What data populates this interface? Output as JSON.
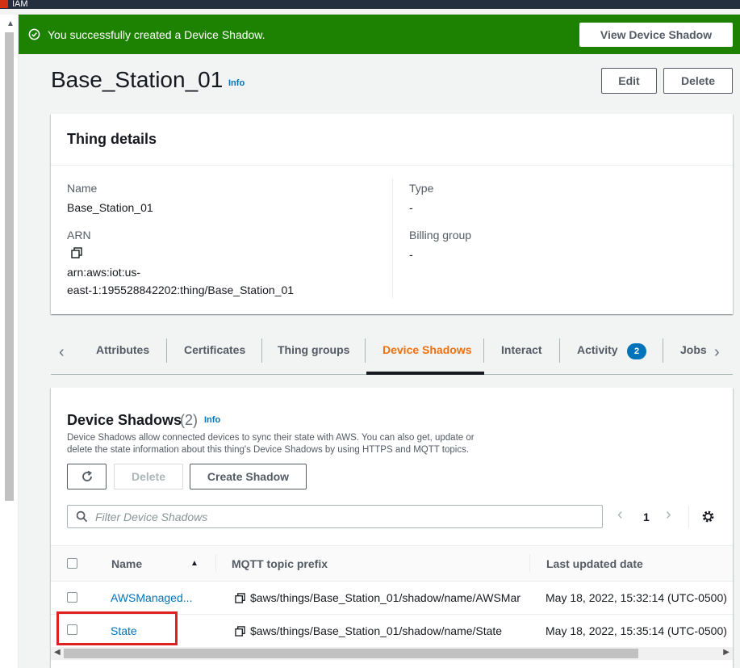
{
  "topbar": {
    "service": "IAM"
  },
  "flash": {
    "message": "You successfully created a Device Shadow.",
    "button": "View Device Shadow",
    "color": "#1d8102"
  },
  "header": {
    "title": "Base_Station_01",
    "info": "Info",
    "edit": "Edit",
    "delete": "Delete"
  },
  "details": {
    "title": "Thing details",
    "name_label": "Name",
    "name_value": "Base_Station_01",
    "arn_label": "ARN",
    "arn_line1": "arn:aws:iot:us-",
    "arn_line2": "east-1:195528842202:thing/Base_Station_01",
    "type_label": "Type",
    "type_value": "-",
    "billing_label": "Billing group",
    "billing_value": "-"
  },
  "tabs": {
    "items": [
      "Attributes",
      "Certificates",
      "Thing groups",
      "Device Shadows",
      "Interact",
      "Activity",
      "Jobs"
    ],
    "active": "Device Shadows",
    "activity_badge": "2",
    "accent": "#ec7211"
  },
  "shadows": {
    "title": "Device Shadows",
    "count": "(2)",
    "info": "Info",
    "desc_line1": "Device Shadows allow connected devices to sync their state with AWS. You can also get, update or",
    "desc_line2": "delete the state information about this thing's Device Shadows by using HTTPS and MQTT topics.",
    "delete": "Delete",
    "create": "Create Shadow",
    "filter_placeholder": "Filter Device Shadows",
    "page": "1",
    "columns": [
      "Name",
      "MQTT topic prefix",
      "Last updated date"
    ],
    "rows": [
      {
        "name": "AWSManaged...",
        "topic": "$aws/things/Base_Station_01/shadow/name/AWSMar",
        "updated": "May 18, 2022, 15:32:14 (UTC-0500)"
      },
      {
        "name": "State",
        "topic": "$aws/things/Base_Station_01/shadow/name/State",
        "updated": "May 18, 2022, 15:35:14 (UTC-0500)"
      }
    ]
  }
}
